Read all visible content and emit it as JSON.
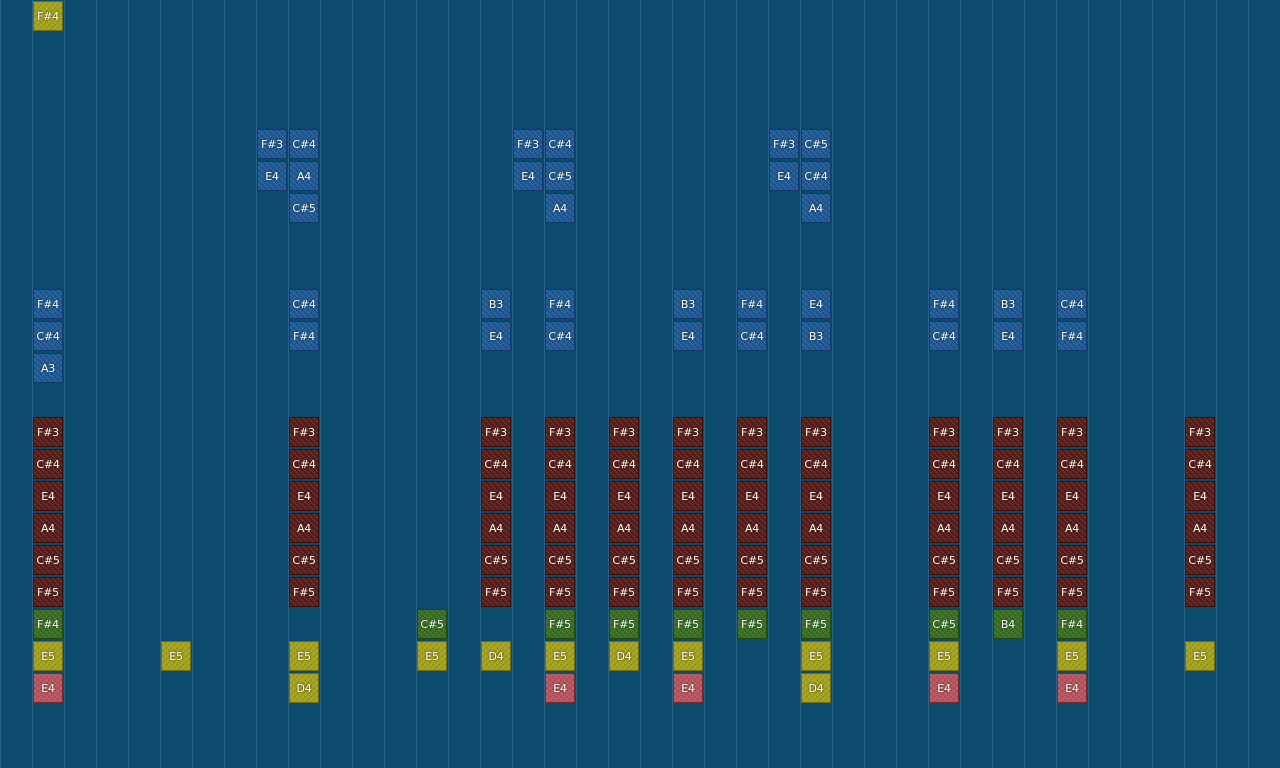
{
  "palette": {
    "background": "#0c4a6e",
    "blue": "#1e5a96",
    "maroon": "#5a1e19",
    "green": "#3a6e22",
    "yellow": "#a5a21b",
    "pink": "#b85560"
  },
  "columns": 40,
  "notes": [
    {
      "label": "F#4",
      "col": 1,
      "row": 0,
      "color": "yellow"
    },
    {
      "label": "F#3",
      "col": 8,
      "row": 4,
      "color": "blue"
    },
    {
      "label": "C#4",
      "col": 9,
      "row": 4,
      "color": "blue"
    },
    {
      "label": "E4",
      "col": 8,
      "row": 5,
      "color": "blue"
    },
    {
      "label": "A4",
      "col": 9,
      "row": 5,
      "color": "blue"
    },
    {
      "label": "C#5",
      "col": 9,
      "row": 6,
      "color": "blue"
    },
    {
      "label": "F#3",
      "col": 16,
      "row": 4,
      "color": "blue"
    },
    {
      "label": "C#4",
      "col": 17,
      "row": 4,
      "color": "blue"
    },
    {
      "label": "E4",
      "col": 16,
      "row": 5,
      "color": "blue"
    },
    {
      "label": "C#5",
      "col": 17,
      "row": 5,
      "color": "blue"
    },
    {
      "label": "A4",
      "col": 17,
      "row": 6,
      "color": "blue"
    },
    {
      "label": "F#3",
      "col": 24,
      "row": 4,
      "color": "blue"
    },
    {
      "label": "C#5",
      "col": 25,
      "row": 4,
      "color": "blue"
    },
    {
      "label": "E4",
      "col": 24,
      "row": 5,
      "color": "blue"
    },
    {
      "label": "C#4",
      "col": 25,
      "row": 5,
      "color": "blue"
    },
    {
      "label": "A4",
      "col": 25,
      "row": 6,
      "color": "blue"
    },
    {
      "label": "F#4",
      "col": 1,
      "row": 9,
      "color": "blue"
    },
    {
      "label": "C#4",
      "col": 1,
      "row": 10,
      "color": "blue"
    },
    {
      "label": "A3",
      "col": 1,
      "row": 11,
      "color": "blue"
    },
    {
      "label": "C#4",
      "col": 9,
      "row": 9,
      "color": "blue"
    },
    {
      "label": "F#4",
      "col": 9,
      "row": 10,
      "color": "blue"
    },
    {
      "label": "B3",
      "col": 15,
      "row": 9,
      "color": "blue"
    },
    {
      "label": "E4",
      "col": 15,
      "row": 10,
      "color": "blue"
    },
    {
      "label": "F#4",
      "col": 17,
      "row": 9,
      "color": "blue"
    },
    {
      "label": "C#4",
      "col": 17,
      "row": 10,
      "color": "blue"
    },
    {
      "label": "B3",
      "col": 21,
      "row": 9,
      "color": "blue"
    },
    {
      "label": "E4",
      "col": 21,
      "row": 10,
      "color": "blue"
    },
    {
      "label": "F#4",
      "col": 23,
      "row": 9,
      "color": "blue"
    },
    {
      "label": "C#4",
      "col": 23,
      "row": 10,
      "color": "blue"
    },
    {
      "label": "E4",
      "col": 25,
      "row": 9,
      "color": "blue"
    },
    {
      "label": "B3",
      "col": 25,
      "row": 10,
      "color": "blue"
    },
    {
      "label": "F#4",
      "col": 29,
      "row": 9,
      "color": "blue"
    },
    {
      "label": "C#4",
      "col": 29,
      "row": 10,
      "color": "blue"
    },
    {
      "label": "B3",
      "col": 31,
      "row": 9,
      "color": "blue"
    },
    {
      "label": "E4",
      "col": 31,
      "row": 10,
      "color": "blue"
    },
    {
      "label": "C#4",
      "col": 33,
      "row": 9,
      "color": "blue"
    },
    {
      "label": "F#4",
      "col": 33,
      "row": 10,
      "color": "blue"
    },
    {
      "label": "F#3",
      "col": 1,
      "row": 13,
      "color": "maroon"
    },
    {
      "label": "C#4",
      "col": 1,
      "row": 14,
      "color": "maroon"
    },
    {
      "label": "E4",
      "col": 1,
      "row": 15,
      "color": "maroon"
    },
    {
      "label": "A4",
      "col": 1,
      "row": 16,
      "color": "maroon"
    },
    {
      "label": "C#5",
      "col": 1,
      "row": 17,
      "color": "maroon"
    },
    {
      "label": "F#5",
      "col": 1,
      "row": 18,
      "color": "maroon"
    },
    {
      "label": "F#3",
      "col": 9,
      "row": 13,
      "color": "maroon"
    },
    {
      "label": "C#4",
      "col": 9,
      "row": 14,
      "color": "maroon"
    },
    {
      "label": "E4",
      "col": 9,
      "row": 15,
      "color": "maroon"
    },
    {
      "label": "A4",
      "col": 9,
      "row": 16,
      "color": "maroon"
    },
    {
      "label": "C#5",
      "col": 9,
      "row": 17,
      "color": "maroon"
    },
    {
      "label": "F#5",
      "col": 9,
      "row": 18,
      "color": "maroon"
    },
    {
      "label": "F#3",
      "col": 15,
      "row": 13,
      "color": "maroon"
    },
    {
      "label": "C#4",
      "col": 15,
      "row": 14,
      "color": "maroon"
    },
    {
      "label": "E4",
      "col": 15,
      "row": 15,
      "color": "maroon"
    },
    {
      "label": "A4",
      "col": 15,
      "row": 16,
      "color": "maroon"
    },
    {
      "label": "C#5",
      "col": 15,
      "row": 17,
      "color": "maroon"
    },
    {
      "label": "F#5",
      "col": 15,
      "row": 18,
      "color": "maroon"
    },
    {
      "label": "F#3",
      "col": 17,
      "row": 13,
      "color": "maroon"
    },
    {
      "label": "C#4",
      "col": 17,
      "row": 14,
      "color": "maroon"
    },
    {
      "label": "E4",
      "col": 17,
      "row": 15,
      "color": "maroon"
    },
    {
      "label": "A4",
      "col": 17,
      "row": 16,
      "color": "maroon"
    },
    {
      "label": "C#5",
      "col": 17,
      "row": 17,
      "color": "maroon"
    },
    {
      "label": "F#5",
      "col": 17,
      "row": 18,
      "color": "maroon"
    },
    {
      "label": "F#3",
      "col": 19,
      "row": 13,
      "color": "maroon"
    },
    {
      "label": "C#4",
      "col": 19,
      "row": 14,
      "color": "maroon"
    },
    {
      "label": "E4",
      "col": 19,
      "row": 15,
      "color": "maroon"
    },
    {
      "label": "A4",
      "col": 19,
      "row": 16,
      "color": "maroon"
    },
    {
      "label": "C#5",
      "col": 19,
      "row": 17,
      "color": "maroon"
    },
    {
      "label": "F#5",
      "col": 19,
      "row": 18,
      "color": "maroon"
    },
    {
      "label": "F#3",
      "col": 21,
      "row": 13,
      "color": "maroon"
    },
    {
      "label": "C#4",
      "col": 21,
      "row": 14,
      "color": "maroon"
    },
    {
      "label": "E4",
      "col": 21,
      "row": 15,
      "color": "maroon"
    },
    {
      "label": "A4",
      "col": 21,
      "row": 16,
      "color": "maroon"
    },
    {
      "label": "C#5",
      "col": 21,
      "row": 17,
      "color": "maroon"
    },
    {
      "label": "F#5",
      "col": 21,
      "row": 18,
      "color": "maroon"
    },
    {
      "label": "F#3",
      "col": 23,
      "row": 13,
      "color": "maroon"
    },
    {
      "label": "C#4",
      "col": 23,
      "row": 14,
      "color": "maroon"
    },
    {
      "label": "E4",
      "col": 23,
      "row": 15,
      "color": "maroon"
    },
    {
      "label": "A4",
      "col": 23,
      "row": 16,
      "color": "maroon"
    },
    {
      "label": "C#5",
      "col": 23,
      "row": 17,
      "color": "maroon"
    },
    {
      "label": "F#5",
      "col": 23,
      "row": 18,
      "color": "maroon"
    },
    {
      "label": "F#3",
      "col": 25,
      "row": 13,
      "color": "maroon"
    },
    {
      "label": "C#4",
      "col": 25,
      "row": 14,
      "color": "maroon"
    },
    {
      "label": "E4",
      "col": 25,
      "row": 15,
      "color": "maroon"
    },
    {
      "label": "A4",
      "col": 25,
      "row": 16,
      "color": "maroon"
    },
    {
      "label": "C#5",
      "col": 25,
      "row": 17,
      "color": "maroon"
    },
    {
      "label": "F#5",
      "col": 25,
      "row": 18,
      "color": "maroon"
    },
    {
      "label": "F#3",
      "col": 29,
      "row": 13,
      "color": "maroon"
    },
    {
      "label": "C#4",
      "col": 29,
      "row": 14,
      "color": "maroon"
    },
    {
      "label": "E4",
      "col": 29,
      "row": 15,
      "color": "maroon"
    },
    {
      "label": "A4",
      "col": 29,
      "row": 16,
      "color": "maroon"
    },
    {
      "label": "C#5",
      "col": 29,
      "row": 17,
      "color": "maroon"
    },
    {
      "label": "F#5",
      "col": 29,
      "row": 18,
      "color": "maroon"
    },
    {
      "label": "F#3",
      "col": 31,
      "row": 13,
      "color": "maroon"
    },
    {
      "label": "C#4",
      "col": 31,
      "row": 14,
      "color": "maroon"
    },
    {
      "label": "E4",
      "col": 31,
      "row": 15,
      "color": "maroon"
    },
    {
      "label": "A4",
      "col": 31,
      "row": 16,
      "color": "maroon"
    },
    {
      "label": "C#5",
      "col": 31,
      "row": 17,
      "color": "maroon"
    },
    {
      "label": "F#5",
      "col": 31,
      "row": 18,
      "color": "maroon"
    },
    {
      "label": "F#3",
      "col": 33,
      "row": 13,
      "color": "maroon"
    },
    {
      "label": "C#4",
      "col": 33,
      "row": 14,
      "color": "maroon"
    },
    {
      "label": "E4",
      "col": 33,
      "row": 15,
      "color": "maroon"
    },
    {
      "label": "A4",
      "col": 33,
      "row": 16,
      "color": "maroon"
    },
    {
      "label": "C#5",
      "col": 33,
      "row": 17,
      "color": "maroon"
    },
    {
      "label": "F#5",
      "col": 33,
      "row": 18,
      "color": "maroon"
    },
    {
      "label": "F#3",
      "col": 37,
      "row": 13,
      "color": "maroon"
    },
    {
      "label": "C#4",
      "col": 37,
      "row": 14,
      "color": "maroon"
    },
    {
      "label": "E4",
      "col": 37,
      "row": 15,
      "color": "maroon"
    },
    {
      "label": "A4",
      "col": 37,
      "row": 16,
      "color": "maroon"
    },
    {
      "label": "C#5",
      "col": 37,
      "row": 17,
      "color": "maroon"
    },
    {
      "label": "F#5",
      "col": 37,
      "row": 18,
      "color": "maroon"
    },
    {
      "label": "F#4",
      "col": 1,
      "row": 19,
      "color": "green"
    },
    {
      "label": "C#5",
      "col": 13,
      "row": 19,
      "color": "green"
    },
    {
      "label": "F#5",
      "col": 17,
      "row": 19,
      "color": "green"
    },
    {
      "label": "F#5",
      "col": 19,
      "row": 19,
      "color": "green"
    },
    {
      "label": "F#5",
      "col": 21,
      "row": 19,
      "color": "green"
    },
    {
      "label": "F#5",
      "col": 23,
      "row": 19,
      "color": "green"
    },
    {
      "label": "F#5",
      "col": 25,
      "row": 19,
      "color": "green"
    },
    {
      "label": "C#5",
      "col": 29,
      "row": 19,
      "color": "green"
    },
    {
      "label": "B4",
      "col": 31,
      "row": 19,
      "color": "green"
    },
    {
      "label": "F#4",
      "col": 33,
      "row": 19,
      "color": "green"
    },
    {
      "label": "E5",
      "col": 1,
      "row": 20,
      "color": "yellow"
    },
    {
      "label": "E5",
      "col": 5,
      "row": 20,
      "color": "yellow"
    },
    {
      "label": "E5",
      "col": 9,
      "row": 20,
      "color": "yellow"
    },
    {
      "label": "E5",
      "col": 13,
      "row": 20,
      "color": "yellow"
    },
    {
      "label": "D4",
      "col": 15,
      "row": 20,
      "color": "yellow"
    },
    {
      "label": "E5",
      "col": 17,
      "row": 20,
      "color": "yellow"
    },
    {
      "label": "D4",
      "col": 19,
      "row": 20,
      "color": "yellow"
    },
    {
      "label": "E5",
      "col": 21,
      "row": 20,
      "color": "yellow"
    },
    {
      "label": "E5",
      "col": 25,
      "row": 20,
      "color": "yellow"
    },
    {
      "label": "E5",
      "col": 29,
      "row": 20,
      "color": "yellow"
    },
    {
      "label": "E5",
      "col": 33,
      "row": 20,
      "color": "yellow"
    },
    {
      "label": "E5",
      "col": 37,
      "row": 20,
      "color": "yellow"
    },
    {
      "label": "E4",
      "col": 1,
      "row": 21,
      "color": "pink"
    },
    {
      "label": "D4",
      "col": 9,
      "row": 21,
      "color": "yellow"
    },
    {
      "label": "E4",
      "col": 17,
      "row": 21,
      "color": "pink"
    },
    {
      "label": "E4",
      "col": 21,
      "row": 21,
      "color": "pink"
    },
    {
      "label": "D4",
      "col": 25,
      "row": 21,
      "color": "yellow"
    },
    {
      "label": "E4",
      "col": 29,
      "row": 21,
      "color": "pink"
    },
    {
      "label": "E4",
      "col": 33,
      "row": 21,
      "color": "pink"
    }
  ]
}
